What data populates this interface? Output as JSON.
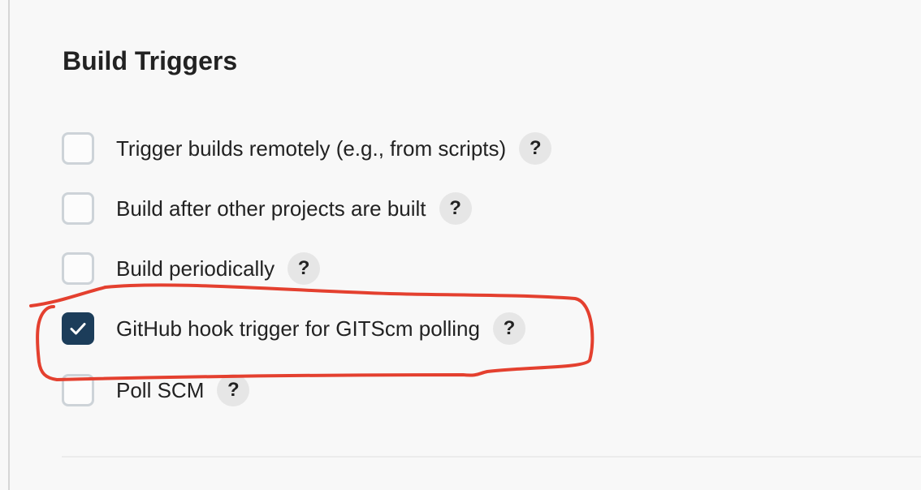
{
  "section": {
    "title": "Build Triggers"
  },
  "triggers": [
    {
      "label": "Trigger builds remotely (e.g., from scripts)",
      "checked": false,
      "help": "?"
    },
    {
      "label": "Build after other projects are built",
      "checked": false,
      "help": "?"
    },
    {
      "label": "Build periodically",
      "checked": false,
      "help": "?"
    },
    {
      "label": "GitHub hook trigger for GITScm polling",
      "checked": true,
      "help": "?"
    },
    {
      "label": "Poll SCM",
      "checked": false,
      "help": "?"
    }
  ],
  "colors": {
    "checked_fill": "#1c3d5a",
    "annotation_red": "#e4402f"
  },
  "icons": {
    "check": "check-icon",
    "help": "help-icon"
  }
}
